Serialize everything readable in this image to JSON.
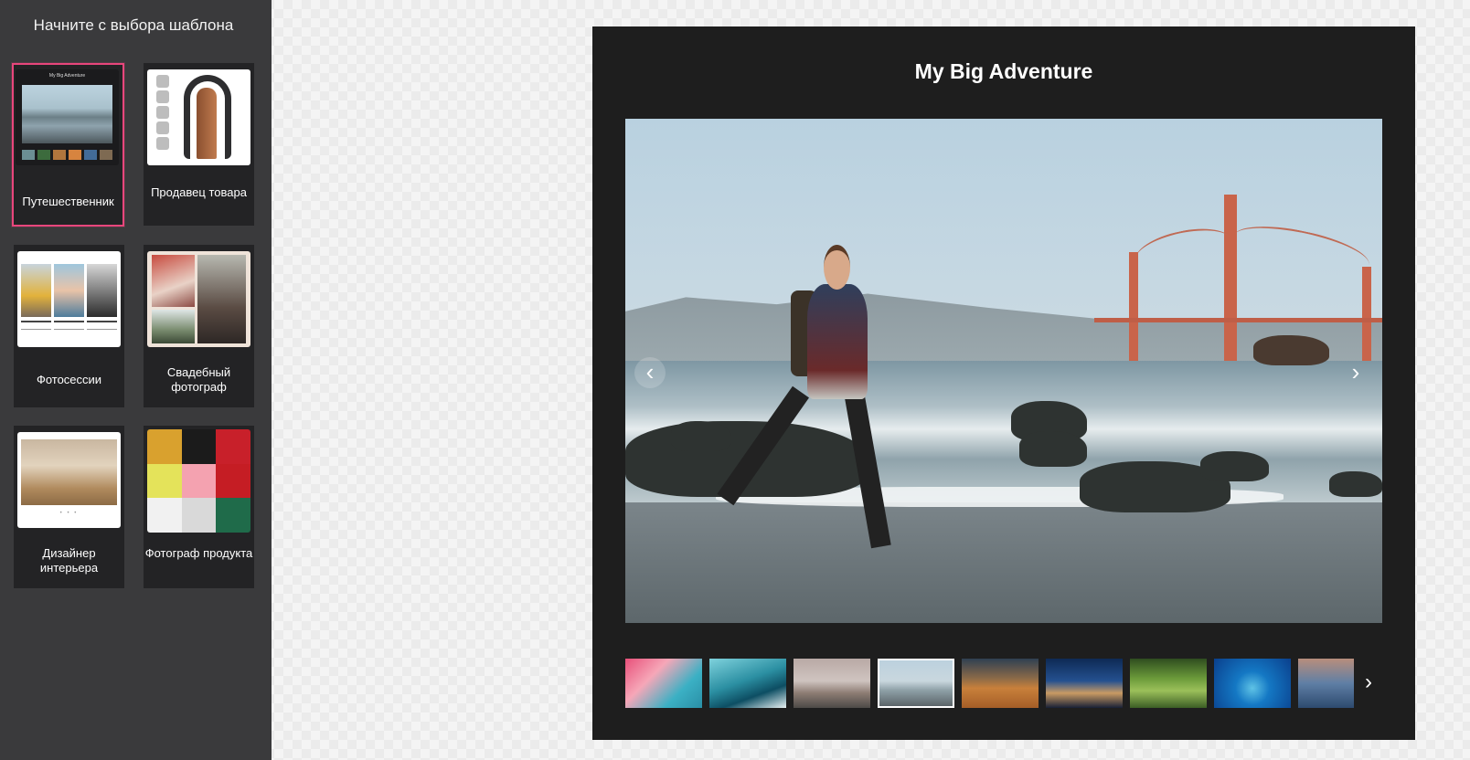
{
  "sidebar": {
    "title": "Начните с выбора шаблона",
    "templates": [
      {
        "label": "Путешественник",
        "selected": true,
        "thumb_title": "My Big Adventure"
      },
      {
        "label": "Продавец товара"
      },
      {
        "label": "Фотосессии"
      },
      {
        "label": "Свадебный фотограф"
      },
      {
        "label": "Дизайнер интерьера"
      },
      {
        "label": "Фотограф продукта"
      }
    ],
    "accent_color": "#e8467c"
  },
  "preview": {
    "title": "My Big Adventure",
    "prev_icon": "‹",
    "next_icon": "›",
    "strip_next_icon": "›",
    "thumbnail_count": 9,
    "active_thumbnail": 4
  }
}
